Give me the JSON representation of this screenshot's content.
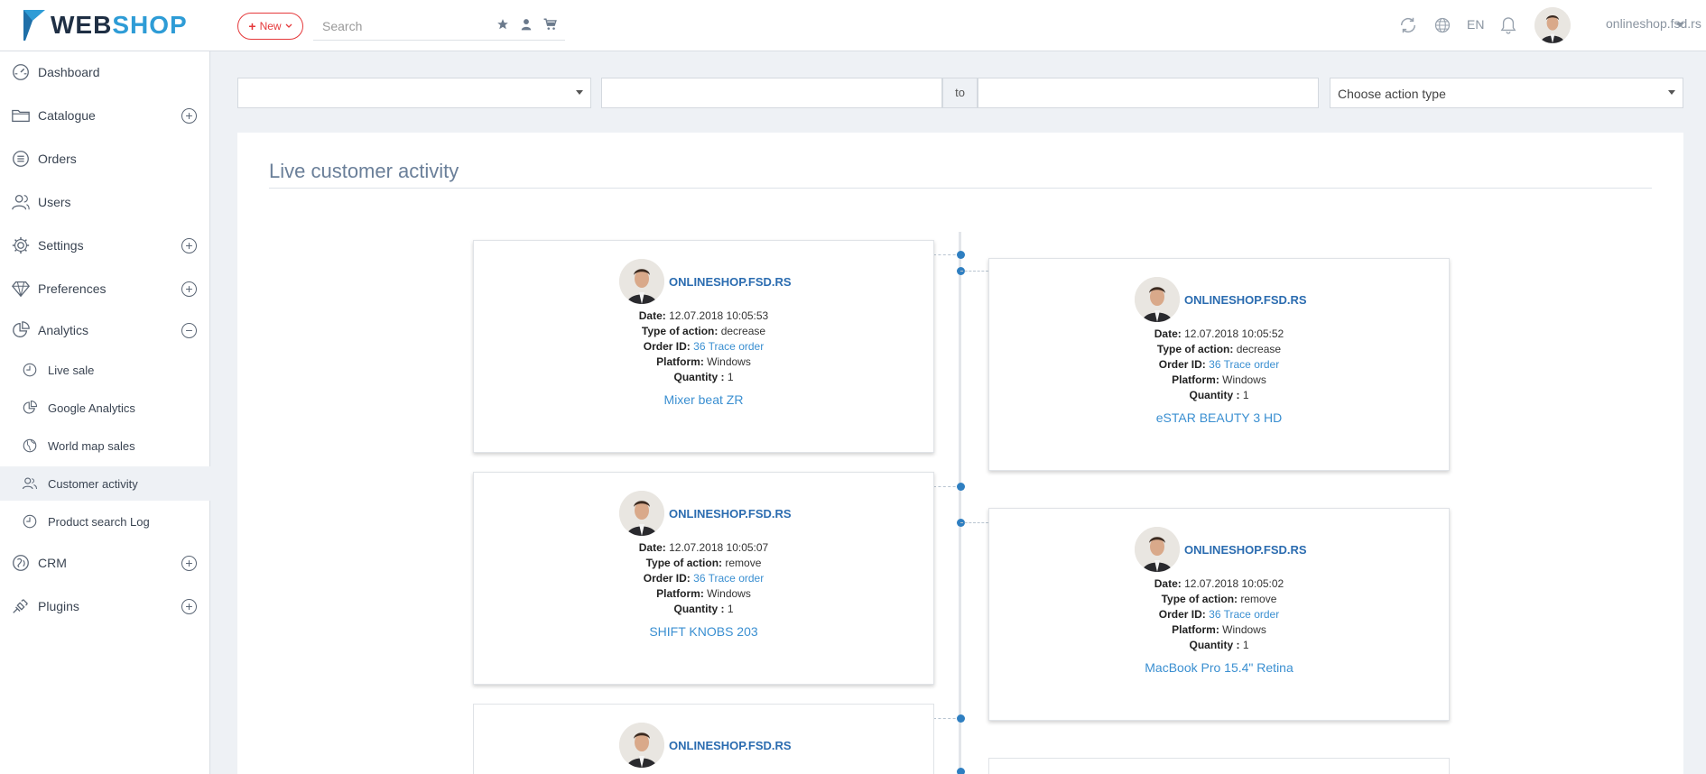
{
  "header": {
    "logo": {
      "part1": "WEB",
      "part2": "SHOP"
    },
    "new_button": "New",
    "search_placeholder": "Search",
    "icons": [
      "star-icon",
      "user-icon",
      "cart-icon",
      "refresh-icon",
      "globe-icon",
      "bell-icon"
    ],
    "language": "EN",
    "user_name": "onlineshop.fsd.rs"
  },
  "sidebar": {
    "items": [
      {
        "label": "Dashboard",
        "icon": "dashboard-icon",
        "expandable": false
      },
      {
        "label": "Catalogue",
        "icon": "folder-icon",
        "expandable": true,
        "state": "+"
      },
      {
        "label": "Orders",
        "icon": "list-icon",
        "expandable": false
      },
      {
        "label": "Users",
        "icon": "users-icon",
        "expandable": false
      },
      {
        "label": "Settings",
        "icon": "gear-icon",
        "expandable": true,
        "state": "+"
      },
      {
        "label": "Preferences",
        "icon": "diamond-icon",
        "expandable": true,
        "state": "+"
      },
      {
        "label": "Analytics",
        "icon": "pie-chart-icon",
        "expandable": true,
        "state": "−"
      },
      {
        "label": "CRM",
        "icon": "crm-icon",
        "expandable": true,
        "state": "+"
      },
      {
        "label": "Plugins",
        "icon": "plugin-icon",
        "expandable": true,
        "state": "+"
      }
    ],
    "analytics_sub": [
      {
        "label": "Live sale",
        "icon": "clock-icon"
      },
      {
        "label": "Google Analytics",
        "icon": "pie-chart-icon"
      },
      {
        "label": "World map sales",
        "icon": "globe-icon"
      },
      {
        "label": "Customer activity",
        "icon": "users-icon",
        "active": true
      },
      {
        "label": "Product search Log",
        "icon": "clock-icon"
      }
    ]
  },
  "filters": {
    "select1_value": "",
    "date_from": "",
    "to_label": "to",
    "date_to": "",
    "action_type_placeholder": "Choose action type"
  },
  "page": {
    "title": "Live customer activity"
  },
  "labels": {
    "date": "Date:",
    "type": "Type of action:",
    "order": "Order ID:",
    "platform": "Platform:",
    "quantity": "Quantity :"
  },
  "activities": [
    {
      "site": "ONLINESHOP.FSD.RS",
      "date": "12.07.2018 10:05:53",
      "type": "decrease",
      "order_id": "36",
      "order_link": "Trace order",
      "platform": "Windows",
      "quantity": "1",
      "product": "Mixer beat ZR"
    },
    {
      "site": "ONLINESHOP.FSD.RS",
      "date": "12.07.2018 10:05:52",
      "type": "decrease",
      "order_id": "36",
      "order_link": "Trace order",
      "platform": "Windows",
      "quantity": "1",
      "product": "eSTAR BEAUTY 3 HD"
    },
    {
      "site": "ONLINESHOP.FSD.RS",
      "date": "12.07.2018 10:05:07",
      "type": "remove",
      "order_id": "36",
      "order_link": "Trace order",
      "platform": "Windows",
      "quantity": "1",
      "product": "SHIFT KNOBS 203"
    },
    {
      "site": "ONLINESHOP.FSD.RS",
      "date": "12.07.2018 10:05:02",
      "type": "remove",
      "order_id": "36",
      "order_link": "Trace order",
      "platform": "Windows",
      "quantity": "1",
      "product": "MacBook Pro 15.4\" Retina"
    },
    {
      "site": "ONLINESHOP.FSD.RS"
    }
  ],
  "colors": {
    "accent": "#2e9cd6",
    "new_button": "#e5393b",
    "link": "#3a8fd1",
    "site_name": "#2b6cb0",
    "timeline_dot": "#2f7fc1"
  }
}
